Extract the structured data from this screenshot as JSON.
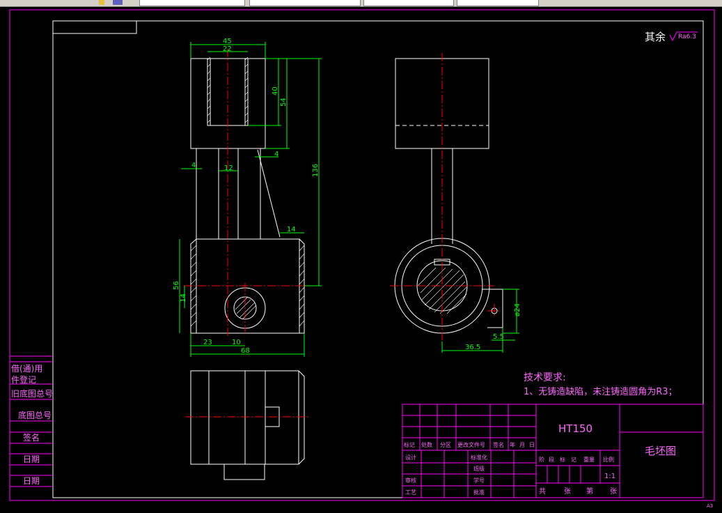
{
  "app": {
    "toolbar": {
      "layer_fields": [
        {
          "name": "linetype-combo"
        },
        {
          "name": "lineweight-combo"
        },
        {
          "name": "plotstyle-combo"
        }
      ],
      "color_combo": {
        "name": "color-combo"
      }
    }
  },
  "drawing": {
    "roughness_note": {
      "prefix": "其余",
      "value": "Ra6.3"
    },
    "dimensions": {
      "top_width": "45",
      "slot_width": "22",
      "slot_depth": "40",
      "head_height": "54",
      "overall_height": "136",
      "wall_left": "4",
      "wall_right": "4",
      "stem_width": "12",
      "chamfer_len": "14",
      "boss_height": "56",
      "hole_offset_v": "14",
      "hole_offset_h": "23",
      "hole_dia_span": "10",
      "base_length": "68",
      "side_hole_dia": "ø24",
      "side_offset": "36.5",
      "side_small": "5.5"
    },
    "tech": {
      "heading": "技术要求:",
      "item1": "1、无铸造缺陷，未注铸造圆角为R3；"
    },
    "left_strip": [
      "借(通)用",
      "件登记",
      "旧底图总号",
      "底图总号",
      "签名",
      "日期",
      "日期"
    ],
    "title_block": {
      "material": "HT150",
      "drawing_name": "毛坯图",
      "header_row": [
        "标记",
        "处数",
        "分区",
        "更改文件号",
        "签名",
        "年",
        "月",
        "日"
      ],
      "row_design": [
        "设计",
        "标准化"
      ],
      "row_review": [
        "审核",
        "学号"
      ],
      "row_process": [
        "工艺",
        "批准"
      ],
      "row_check": "班级",
      "stage_header": [
        "阶",
        "段",
        "标",
        "记",
        "重量",
        "比例"
      ],
      "scale": "1:1",
      "footer": [
        "共",
        "张",
        "第",
        "张"
      ]
    },
    "sheet_size": "A3",
    "colors": {
      "outline": "#ffffff",
      "dimension": "#00ff00",
      "centerline": "#ff0000",
      "frame": "#ff00ff",
      "text_magenta": "#ff66ff",
      "hatch": "#ffffff"
    }
  }
}
